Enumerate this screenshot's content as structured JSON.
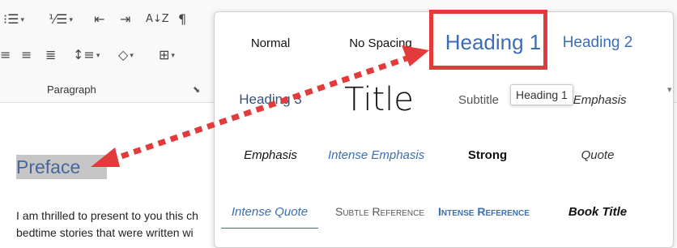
{
  "ribbon": {
    "paragraph_label": "Paragraph",
    "launcher_glyph": "⬊",
    "buttons": {
      "bullets_icon": "⁝☰",
      "numbering_icon": "⅟☰",
      "decrease_indent_icon": "⇤",
      "increase_indent_icon": "⇥",
      "sort_label": "A↓Z",
      "pilcrow": "¶",
      "align_left_icon": "≡",
      "align_right_icon": "≡",
      "justify_icon": "≣",
      "line_spacing_icon": "↕≡",
      "shading_icon": "◇",
      "borders_icon": "⊞",
      "caret": "▾"
    }
  },
  "document": {
    "preface_heading": "Preface",
    "body_line1": "I am thrilled to present to you this ch",
    "body_line2": "bedtime stories that were written wi"
  },
  "styles_gallery": {
    "items": [
      {
        "label": "Normal"
      },
      {
        "label": "No Spacing"
      },
      {
        "label": "Heading 1"
      },
      {
        "label": "Heading 2"
      },
      {
        "label": "Heading 3"
      },
      {
        "label": "Title"
      },
      {
        "label": "Subtitle"
      },
      {
        "label": "Subtle Emphasis"
      },
      {
        "label": "Emphasis"
      },
      {
        "label": "Intense Emphasis"
      },
      {
        "label": "Strong"
      },
      {
        "label": "Quote"
      },
      {
        "label": "Intense Quote"
      },
      {
        "label": "Subtle Reference"
      },
      {
        "label": "Intense Reference"
      },
      {
        "label": "Book Title"
      }
    ],
    "tooltip": "Heading 1",
    "highlighted_item": "Heading 1"
  },
  "colors": {
    "accent_blue": "#3d6eb3",
    "annotation_red": "#e33b3b"
  }
}
